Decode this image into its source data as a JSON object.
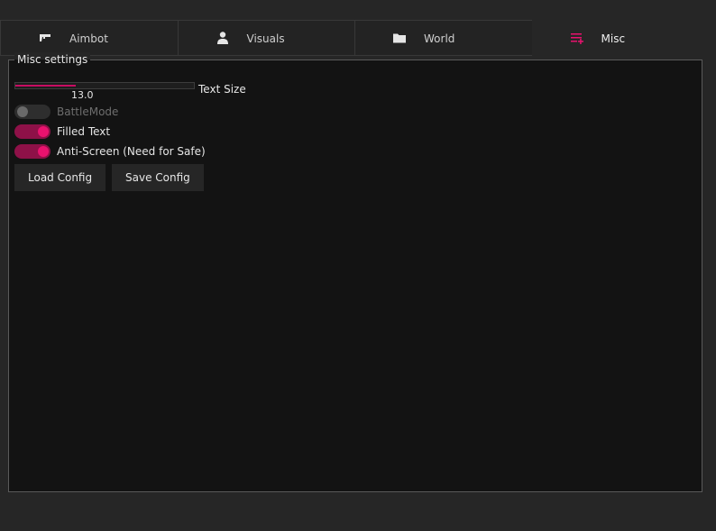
{
  "tabs": [
    {
      "label": "Aimbot",
      "icon": "pistol-icon"
    },
    {
      "label": "Visuals",
      "icon": "person-icon"
    },
    {
      "label": "World",
      "icon": "folder-icon"
    },
    {
      "label": "Misc",
      "icon": "list-add-icon",
      "active": true
    }
  ],
  "panel": {
    "title": "Misc settings"
  },
  "slider": {
    "label": "Text Size",
    "value": "13.0",
    "fill_fraction": 0.34
  },
  "toggles": [
    {
      "label": "BattleMode",
      "state": false
    },
    {
      "label": "Filled Text",
      "state": true
    },
    {
      "label": "Anti-Screen (Need for Safe)",
      "state": true
    }
  ],
  "buttons": {
    "load": "Load Config",
    "save": "Save Config"
  },
  "colors": {
    "accent": "#e8126e",
    "accent_dark": "#8e1148",
    "panel_bg": "#131313",
    "window_bg": "#262626"
  }
}
